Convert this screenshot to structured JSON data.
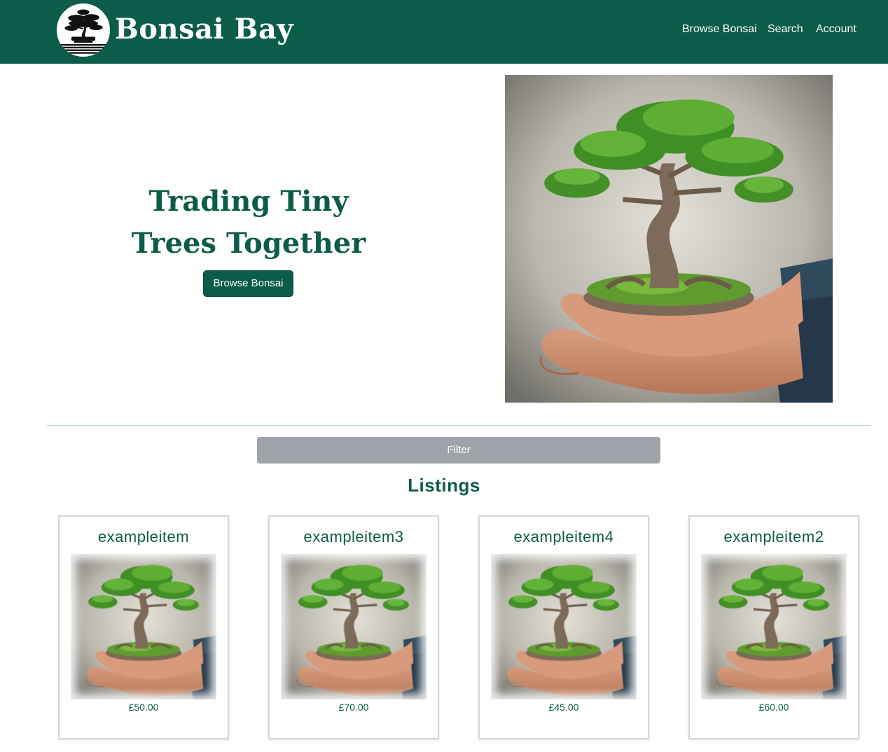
{
  "header": {
    "brand": "Bonsai Bay",
    "nav": {
      "browse": "Browse Bonsai",
      "search": "Search",
      "account": "Account"
    }
  },
  "hero": {
    "title_line1": "Trading Tiny",
    "title_line2": "Trees Together",
    "cta_label": "Browse Bonsai",
    "image_icon": "bonsai-in-hands-photo"
  },
  "filter": {
    "label": "Filter"
  },
  "listings": {
    "heading": "Listings",
    "items": [
      {
        "title": "exampleitem",
        "price": "£50.00"
      },
      {
        "title": "exampleitem3",
        "price": "£70.00"
      },
      {
        "title": "exampleitem4",
        "price": "£45.00"
      },
      {
        "title": "exampleitem2",
        "price": "£60.00"
      }
    ]
  },
  "colors": {
    "brand": "#0c5c4a",
    "filter_button": "#9ea3a9",
    "divider": "#b7d3cb"
  }
}
